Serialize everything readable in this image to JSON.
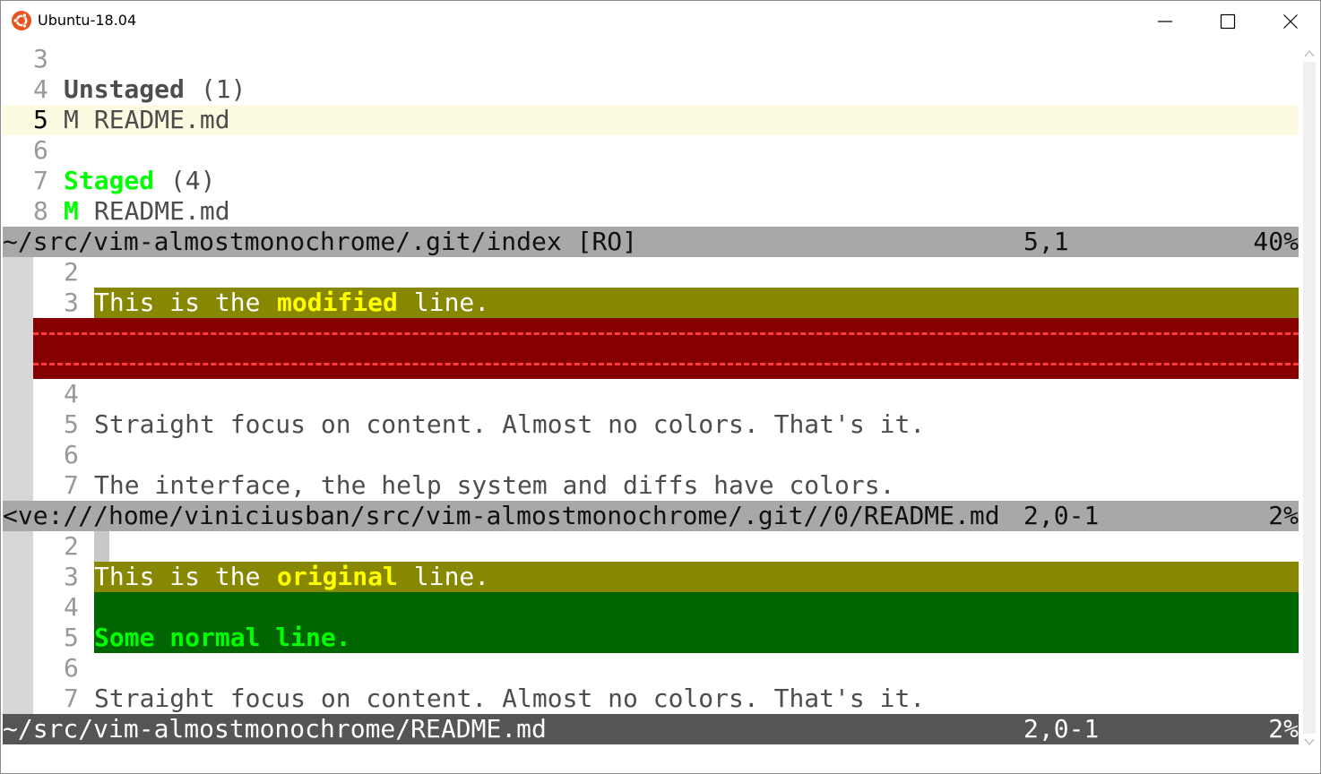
{
  "window": {
    "title": "Ubuntu-18.04",
    "icon": "ubuntu-logo-icon",
    "controls": [
      "minimize-icon",
      "maximize-icon",
      "close-icon"
    ]
  },
  "colors": {
    "cursorline": "#fcfae0",
    "statusline_inactive": "#a8a8a8",
    "statusline_active": "#555555",
    "diff_change": "#878700",
    "diff_text": "#ffff00",
    "diff_delete": "#870000",
    "diff_delete_fill": "#ff3b3b",
    "diff_add": "#006400",
    "diff_add_text": "#00ff00",
    "staged": "#00ff00",
    "sign_column": "#d7d7d7"
  },
  "pane1": {
    "lines": [
      {
        "num": "3",
        "text": ""
      },
      {
        "num": "4",
        "head": "Unstaged",
        "rest": " (1)"
      },
      {
        "num": "5",
        "mark": "M",
        "file": " README.md",
        "current": true
      },
      {
        "num": "6",
        "text": ""
      },
      {
        "num": "7",
        "head": "Staged",
        "rest": " (4)"
      },
      {
        "num": "8",
        "mark": "M",
        "file": " README.md"
      }
    ],
    "status": {
      "path": "~/src/vim-almostmonochrome/.git/index [RO]",
      "pos": "5,1",
      "pct": "40%"
    }
  },
  "pane2": {
    "lines": [
      {
        "num": "2",
        "text": ""
      },
      {
        "num": "3",
        "a": "This is the ",
        "b": "modified",
        "c": " line."
      },
      {
        "num": "4",
        "text": ""
      },
      {
        "num": "5",
        "text": "Straight focus on content. Almost no colors. That's it."
      },
      {
        "num": "6",
        "text": ""
      },
      {
        "num": "7",
        "text": "The interface, the help system and diffs have colors."
      }
    ],
    "status": {
      "path": "<ve:///home/viniciusban/src/vim-almostmonochrome/.git//0/README.md",
      "pos": "2,0-1",
      "pct": "2%"
    }
  },
  "pane3": {
    "lines": [
      {
        "num": "2",
        "text": ""
      },
      {
        "num": "3",
        "a": "This is the ",
        "b": "original",
        "c": " line."
      },
      {
        "num": "4",
        "text": ""
      },
      {
        "num": "5",
        "text": "Some normal line."
      },
      {
        "num": "6",
        "text": ""
      },
      {
        "num": "7",
        "text": "Straight focus on content. Almost no colors. That's it."
      }
    ],
    "status": {
      "path": "~/src/vim-almostmonochrome/README.md",
      "pos": "2,0-1",
      "pct": "2%"
    }
  }
}
